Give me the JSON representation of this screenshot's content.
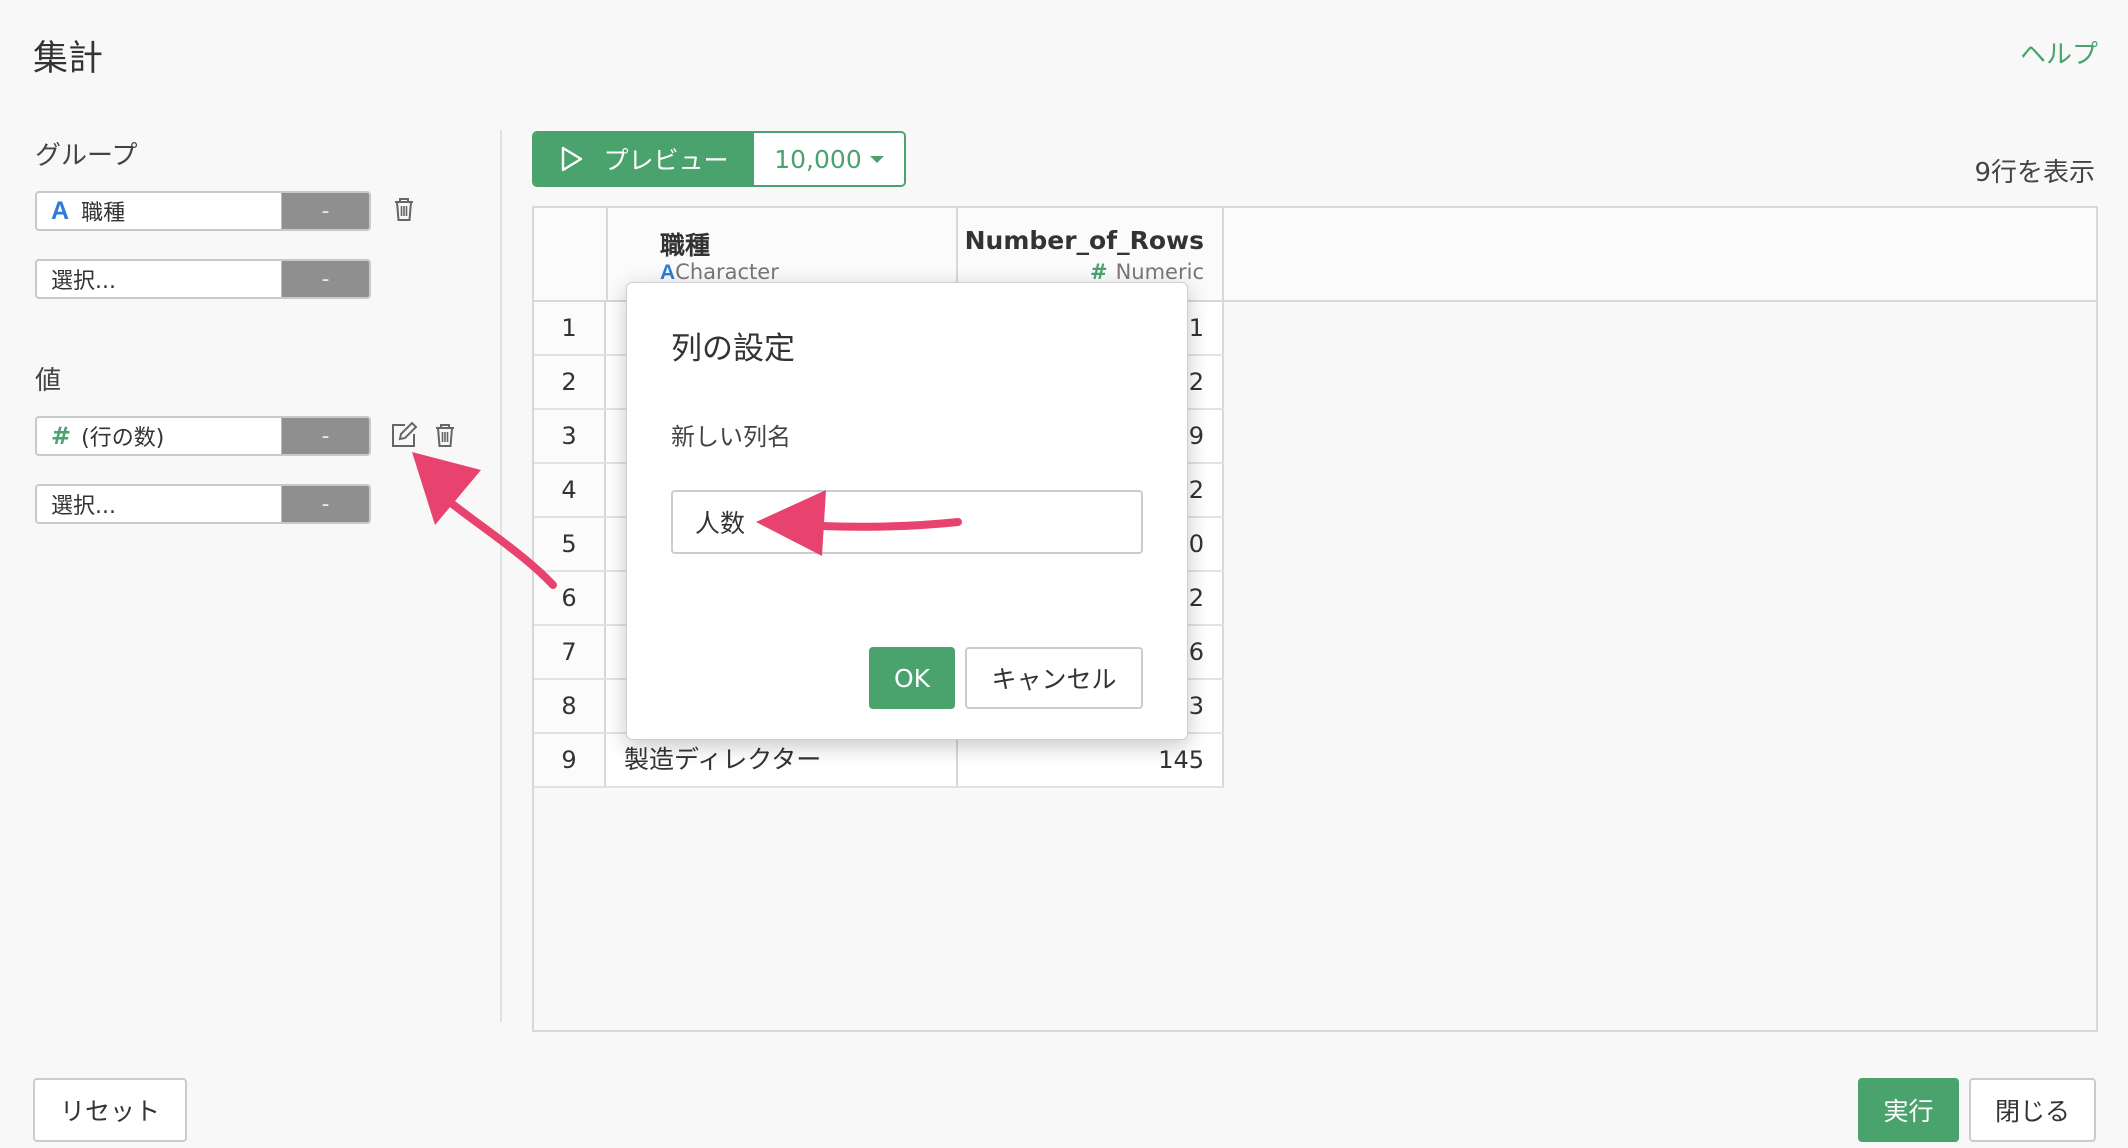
{
  "header": {
    "title": "集計",
    "help": "ヘルプ"
  },
  "sidebar": {
    "group_label": "グループ",
    "group_items": [
      {
        "type_icon": "A",
        "label": "職種",
        "dash": "-"
      },
      {
        "label": "選択...",
        "dash": "-"
      }
    ],
    "value_label": "値",
    "value_items": [
      {
        "type_icon": "#",
        "label": "(行の数)",
        "dash": "-"
      },
      {
        "label": "選択...",
        "dash": "-"
      }
    ]
  },
  "toolbar": {
    "preview_label": "プレビュー",
    "rows_limit": "10,000",
    "row_count_text": "9行を表示"
  },
  "table": {
    "columns": [
      {
        "name": "職種",
        "type_icon": "A",
        "type": "Character"
      },
      {
        "name": "Number_of_Rows",
        "type_icon": "#",
        "type": "Numeric"
      }
    ],
    "rows": [
      {
        "num": "1",
        "name": "",
        "value": "1"
      },
      {
        "num": "2",
        "name": "",
        "value": "2"
      },
      {
        "num": "3",
        "name": "",
        "value": "9"
      },
      {
        "num": "4",
        "name": "",
        "value": "2"
      },
      {
        "num": "5",
        "name": "",
        "value": "0"
      },
      {
        "num": "6",
        "name": "",
        "value": "2"
      },
      {
        "num": "7",
        "name": "",
        "value": "6"
      },
      {
        "num": "8",
        "name": "",
        "value": "3"
      },
      {
        "num": "9",
        "name": "製造ディレクター",
        "value": "145"
      }
    ]
  },
  "modal": {
    "title": "列の設定",
    "field_label": "新しい列名",
    "input_value": "人数",
    "ok": "OK",
    "cancel": "キャンセル"
  },
  "footer": {
    "reset": "リセット",
    "run": "実行",
    "close": "閉じる"
  },
  "colors": {
    "accent": "#4aa36d",
    "annotation": "#e8436f",
    "char_type": "#2f7bd6"
  }
}
